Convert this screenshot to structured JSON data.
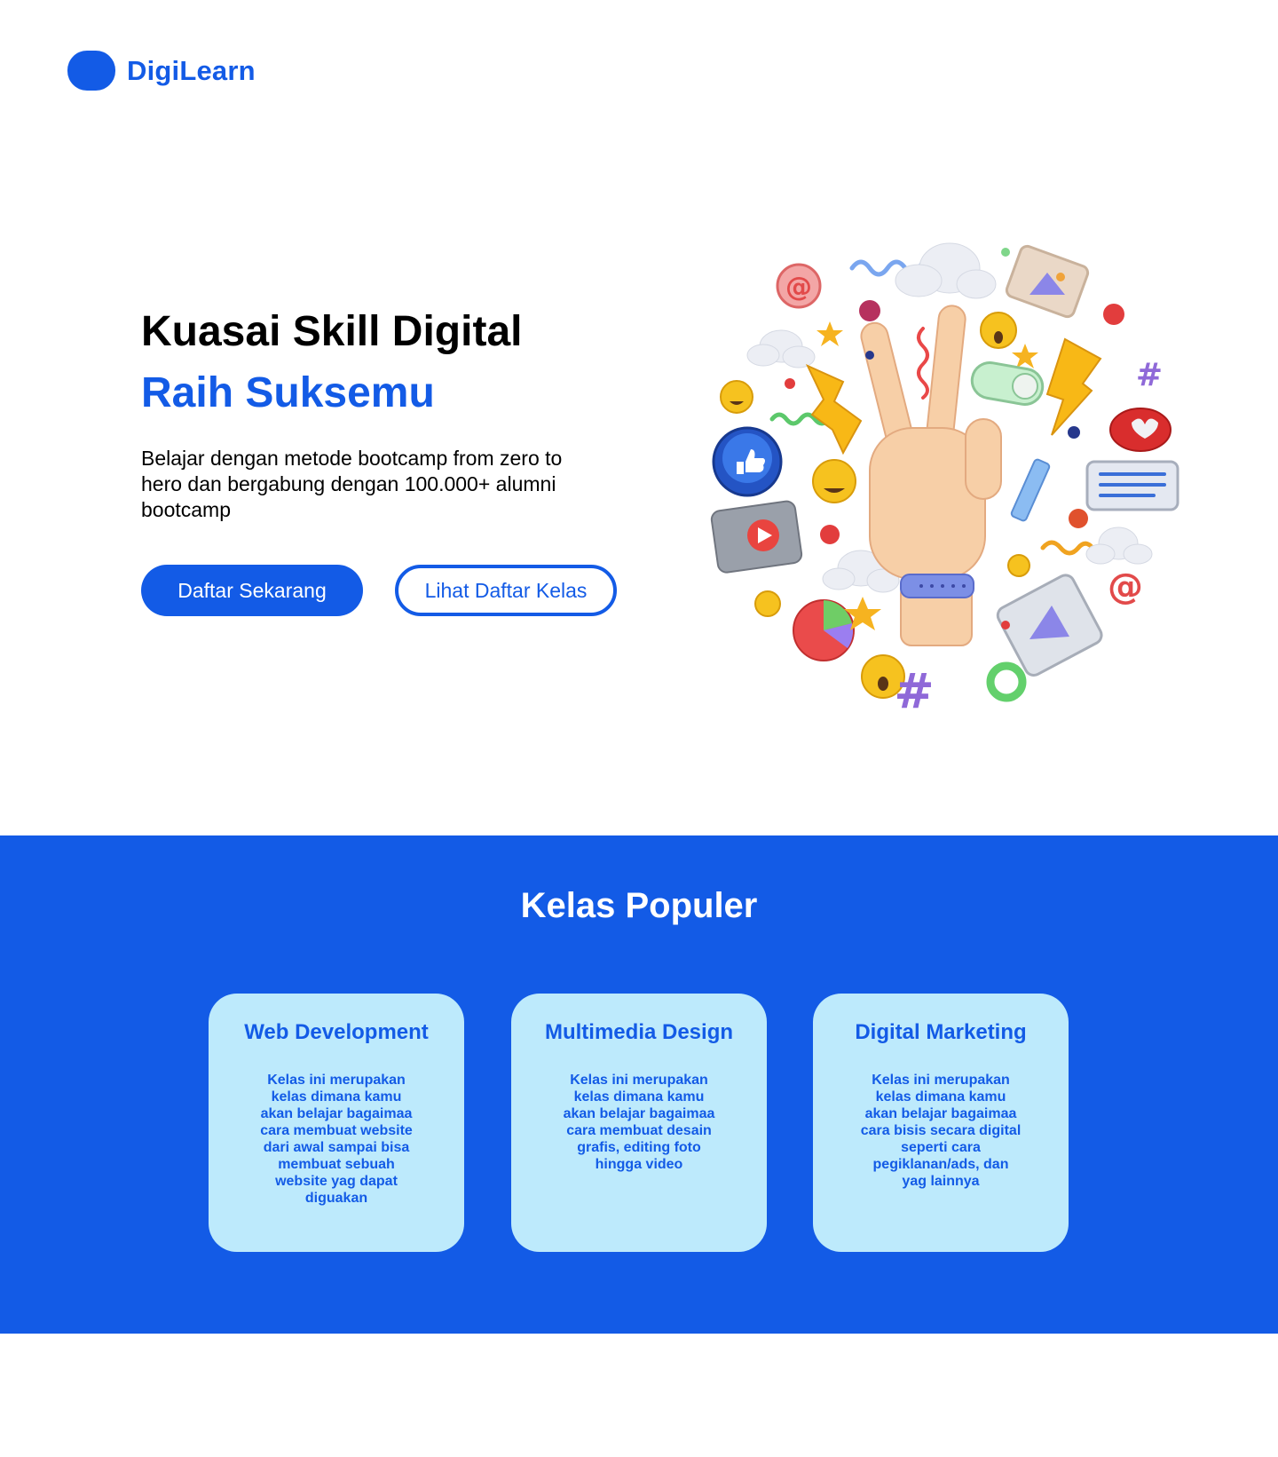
{
  "header": {
    "brand": "DigiLearn"
  },
  "hero": {
    "title": "Kuasai Skill Digital",
    "subtitle": "Raih Suksemu",
    "description": "Belajar dengan metode bootcamp from zero to hero dan bergabung dengan 100.000+ alumni bootcamp",
    "primary_button": "Daftar Sekarang",
    "secondary_button": "Lihat Daftar Kelas"
  },
  "popular": {
    "title": "Kelas Populer",
    "cards": [
      {
        "title": "Web Development",
        "description": "Kelas ini merupakan kelas dimana kamu akan belajar bagaimaa cara membuat website dari awal sampai bisa membuat sebuah website yag dapat diguakan"
      },
      {
        "title": "Multimedia Design",
        "description": "Kelas ini merupakan kelas dimana kamu akan belajar bagaimaa cara membuat desain grafis, editing foto hingga video"
      },
      {
        "title": "Digital Marketing",
        "description": "Kelas ini merupakan kelas dimana kamu akan belajar bagaimaa cara bisis secara digital seperti cara pegiklanan/ads, dan yag lainnya"
      }
    ]
  },
  "colors": {
    "brand": "#135be6",
    "card_bg": "#bdeafc",
    "white": "#ffffff"
  }
}
